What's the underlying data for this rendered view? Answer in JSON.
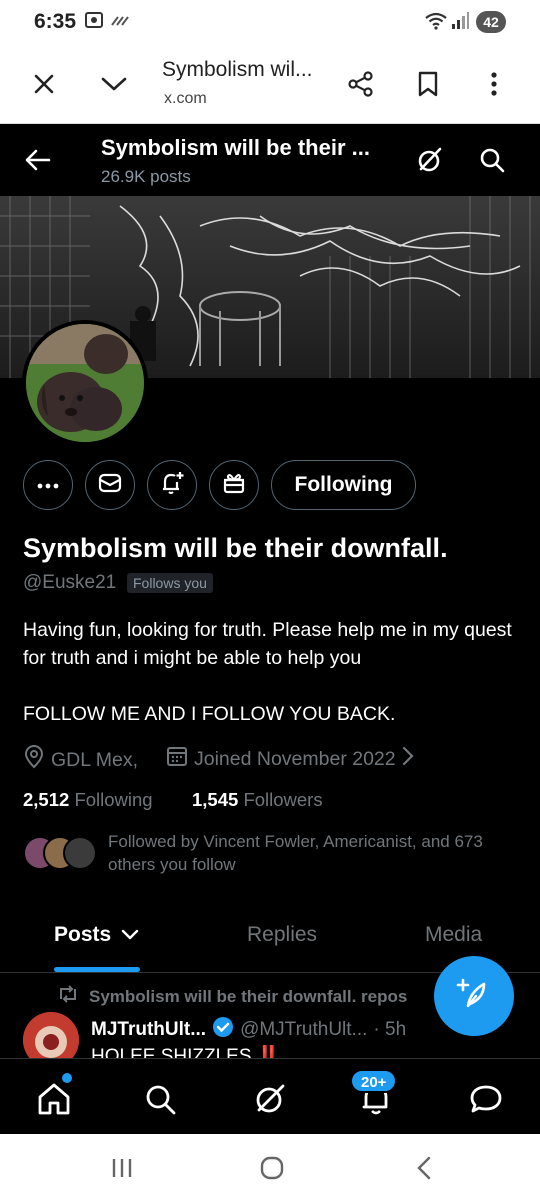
{
  "status_bar": {
    "time": "6:35",
    "battery": "42"
  },
  "browser": {
    "title": "Symbolism wil...",
    "url": "x.com",
    "icons": [
      "close-icon",
      "chevron-down-icon",
      "share-icon",
      "bookmark-icon",
      "more-vertical-icon"
    ]
  },
  "header": {
    "title": "Symbolism will be their ...",
    "posts_count": "26.9K posts"
  },
  "profile": {
    "following_button": "Following",
    "display_name": "Symbolism will be their downfall.",
    "handle": "@Euske21",
    "follows_you": "Follows you",
    "bio_line1": "Having fun, looking for truth. Please help me in my quest for truth  and i might be able to help you",
    "bio_line2": "FOLLOW ME AND I FOLLOW YOU BACK.",
    "location": "GDL Mex,",
    "joined": "Joined November 2022",
    "following_count": "2,512",
    "following_label": "Following",
    "followers_count": "1,545",
    "followers_label": "Followers",
    "followed_by": "Followed by Vincent Fowler, Americanist, and 673 others you follow"
  },
  "tabs": [
    {
      "label": "Posts",
      "active": true
    },
    {
      "label": "Replies",
      "active": false
    },
    {
      "label": "Media",
      "active": false
    }
  ],
  "tweet": {
    "repost_text": "Symbolism will be their downfall. repos",
    "author_name": "MJTruthUlt...",
    "author_handle": "@MJTruthUlt...",
    "time": "· 5h",
    "text": "HOLEE SHIZZLES ‼️"
  },
  "bottom_nav": {
    "notifications_badge": "20+"
  },
  "colors": {
    "accent": "#1d9bf0",
    "background": "#000000",
    "muted": "#71767b"
  }
}
